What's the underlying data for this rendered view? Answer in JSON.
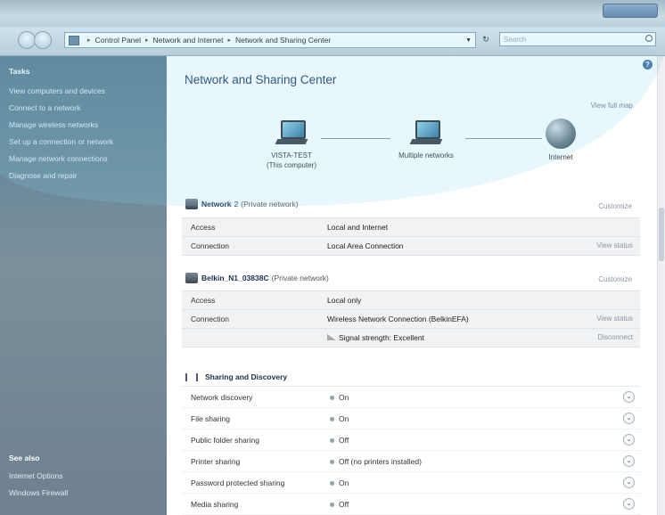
{
  "address": {
    "crumbs": [
      "Control Panel",
      "Network and Internet",
      "Network and Sharing Center"
    ],
    "search_placeholder": "Search"
  },
  "sidebar": {
    "tasks_header": "Tasks",
    "tasks": [
      "View computers and devices",
      "Connect to a network",
      "Manage wireless networks",
      "Set up a connection or network",
      "Manage network connections",
      "Diagnose and repair"
    ],
    "see_also_header": "See also",
    "see_also": [
      "Internet Options",
      "Windows Firewall"
    ]
  },
  "main": {
    "title": "Network and Sharing Center",
    "view_full_map": "View full map",
    "map": {
      "computer_name": "VISTA-TEST",
      "computer_sub": "(This computer)",
      "middle": "Multiple networks",
      "internet": "Internet"
    },
    "networks": [
      {
        "name": "Network",
        "suffix": "2",
        "type": "(Private network)",
        "customize": "Customize",
        "access_label": "Access",
        "access": "Local and Internet",
        "connection_label": "Connection",
        "connection": "Local Area Connection",
        "view_status": "View status"
      },
      {
        "name": "Belkin_N1_03838C",
        "type": "(Private network)",
        "customize": "Customize",
        "access_label": "Access",
        "access": "Local only",
        "connection_label": "Connection",
        "connection": "Wireless Network Connection (BelkinEFA)",
        "view_status": "View status",
        "signal": "Signal strength: Excellent",
        "disconnect": "Disconnect"
      }
    ],
    "sharing": {
      "header": "Sharing and Discovery",
      "rows": [
        {
          "label": "Network discovery",
          "value": "On"
        },
        {
          "label": "File sharing",
          "value": "On"
        },
        {
          "label": "Public folder sharing",
          "value": "Off"
        },
        {
          "label": "Printer sharing",
          "value": "Off (no printers installed)"
        },
        {
          "label": "Password protected sharing",
          "value": "On"
        },
        {
          "label": "Media sharing",
          "value": "Off"
        }
      ]
    }
  }
}
